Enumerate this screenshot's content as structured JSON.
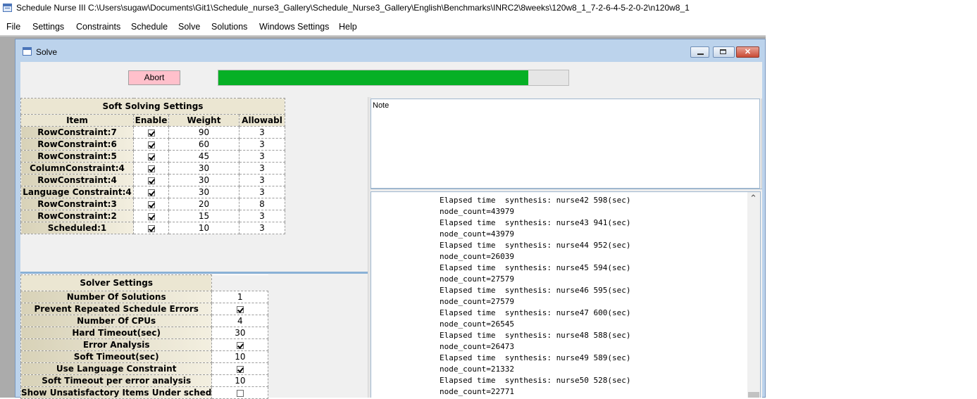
{
  "window": {
    "title": "Schedule Nurse III   C:\\Users\\sugaw\\Documents\\Git1\\Schedule_nurse3_Gallery\\Schedule_Nurse3_Gallery\\English\\Benchmarks\\INRC2\\8weeks\\120w8_1_7-2-6-4-5-2-0-2\\n120w8_1"
  },
  "menu": [
    "File",
    "Settings",
    "Constraints",
    "Schedule",
    "Solve",
    "Solutions",
    "Windows Settings",
    "Help"
  ],
  "solve_window": {
    "caption": "Solve",
    "close_glyph": "✕",
    "abort_label": "Abort",
    "progress_fraction": 0.885,
    "progress_color": "#06b025"
  },
  "soft_settings": {
    "title": "Soft Solving Settings",
    "columns": [
      "Item",
      "Enable",
      "Weight",
      "Allowabl"
    ],
    "rows": [
      {
        "item": "RowConstraint:7",
        "enable": true,
        "weight": "90",
        "allowable": "3"
      },
      {
        "item": "RowConstraint:6",
        "enable": true,
        "weight": "60",
        "allowable": "3"
      },
      {
        "item": "RowConstraint:5",
        "enable": true,
        "weight": "45",
        "allowable": "3"
      },
      {
        "item": "ColumnConstraint:4",
        "enable": true,
        "weight": "30",
        "allowable": "3"
      },
      {
        "item": "RowConstraint:4",
        "enable": true,
        "weight": "30",
        "allowable": "3"
      },
      {
        "item": "Language Constraint:4",
        "enable": true,
        "weight": "30",
        "allowable": "3"
      },
      {
        "item": "RowConstraint:3",
        "enable": true,
        "weight": "20",
        "allowable": "8"
      },
      {
        "item": "RowConstraint:2",
        "enable": true,
        "weight": "15",
        "allowable": "3"
      },
      {
        "item": "Scheduled:1",
        "enable": true,
        "weight": "10",
        "allowable": "3"
      }
    ]
  },
  "solver_settings": {
    "title": "Solver Settings",
    "rows": [
      {
        "label": "Number Of Solutions",
        "value": "1"
      },
      {
        "label": "Prevent Repeated Schedule Errors",
        "checked": true
      },
      {
        "label": "Number Of CPUs",
        "value": "4"
      },
      {
        "label": "Hard Timeout(sec)",
        "value": "30"
      },
      {
        "label": "Error Analysis",
        "checked": true
      },
      {
        "label": "Soft Timeout(sec)",
        "value": "10"
      },
      {
        "label": "Use Language Constraint",
        "checked": true
      },
      {
        "label": "Soft Timeout per error analysis",
        "value": "10"
      },
      {
        "label": "Show Unsatisfactory Items Under sched",
        "checked": false
      }
    ]
  },
  "note": {
    "label": "Note"
  },
  "log": [
    "Elapsed time  synthesis: nurse42 598(sec)",
    "node_count=43979",
    "Elapsed time  synthesis: nurse43 941(sec)",
    "node_count=43979",
    "Elapsed time  synthesis: nurse44 952(sec)",
    "node_count=26039",
    "Elapsed time  synthesis: nurse45 594(sec)",
    "node_count=27579",
    "Elapsed time  synthesis: nurse46 595(sec)",
    "node_count=27579",
    "Elapsed time  synthesis: nurse47 600(sec)",
    "node_count=26545",
    "Elapsed time  synthesis: nurse48 588(sec)",
    "node_count=26473",
    "Elapsed time  synthesis: nurse49 589(sec)",
    "node_count=21332",
    "Elapsed time  synthesis: nurse50 528(sec)",
    "node_count=22771"
  ]
}
